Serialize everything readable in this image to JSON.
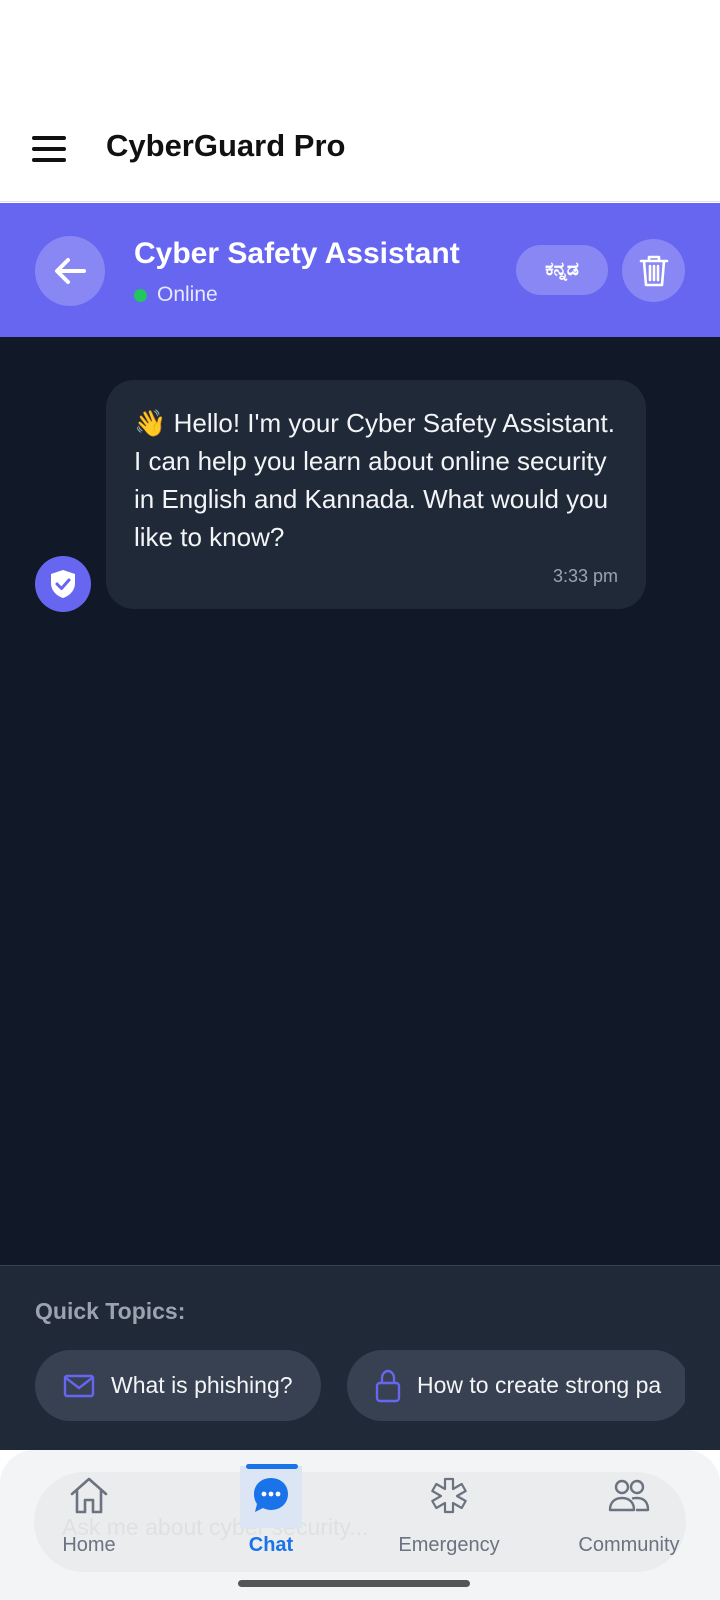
{
  "app": {
    "title": "CyberGuard Pro"
  },
  "header": {
    "title": "Cyber Safety Assistant",
    "status": "Online",
    "language_button": "ಕನ್ನಡ"
  },
  "messages": [
    {
      "sender": "bot",
      "text": "👋 Hello! I'm your Cyber Safety Assistant. I can help you learn about online security in English and Kannada. What would you like to know?",
      "time": "3:33 pm"
    }
  ],
  "quick_topics": {
    "title": "Quick Topics:",
    "items": [
      {
        "label": "What is phishing?",
        "icon": "mail-icon"
      },
      {
        "label": "How to create strong pa",
        "icon": "lock-icon"
      }
    ]
  },
  "input": {
    "placeholder": "Ask me about cyber security..."
  },
  "nav": {
    "items": [
      {
        "label": "Home",
        "icon": "home-icon"
      },
      {
        "label": "Chat",
        "icon": "chat-icon",
        "active": true
      },
      {
        "label": "Emergency",
        "icon": "medical-icon"
      },
      {
        "label": "Community",
        "icon": "people-icon"
      }
    ]
  },
  "colors": {
    "primary": "#6766f1",
    "chat_background": "#111827",
    "bubble": "#1f2937",
    "online": "#22c55e",
    "nav_active": "#1a73e8"
  }
}
